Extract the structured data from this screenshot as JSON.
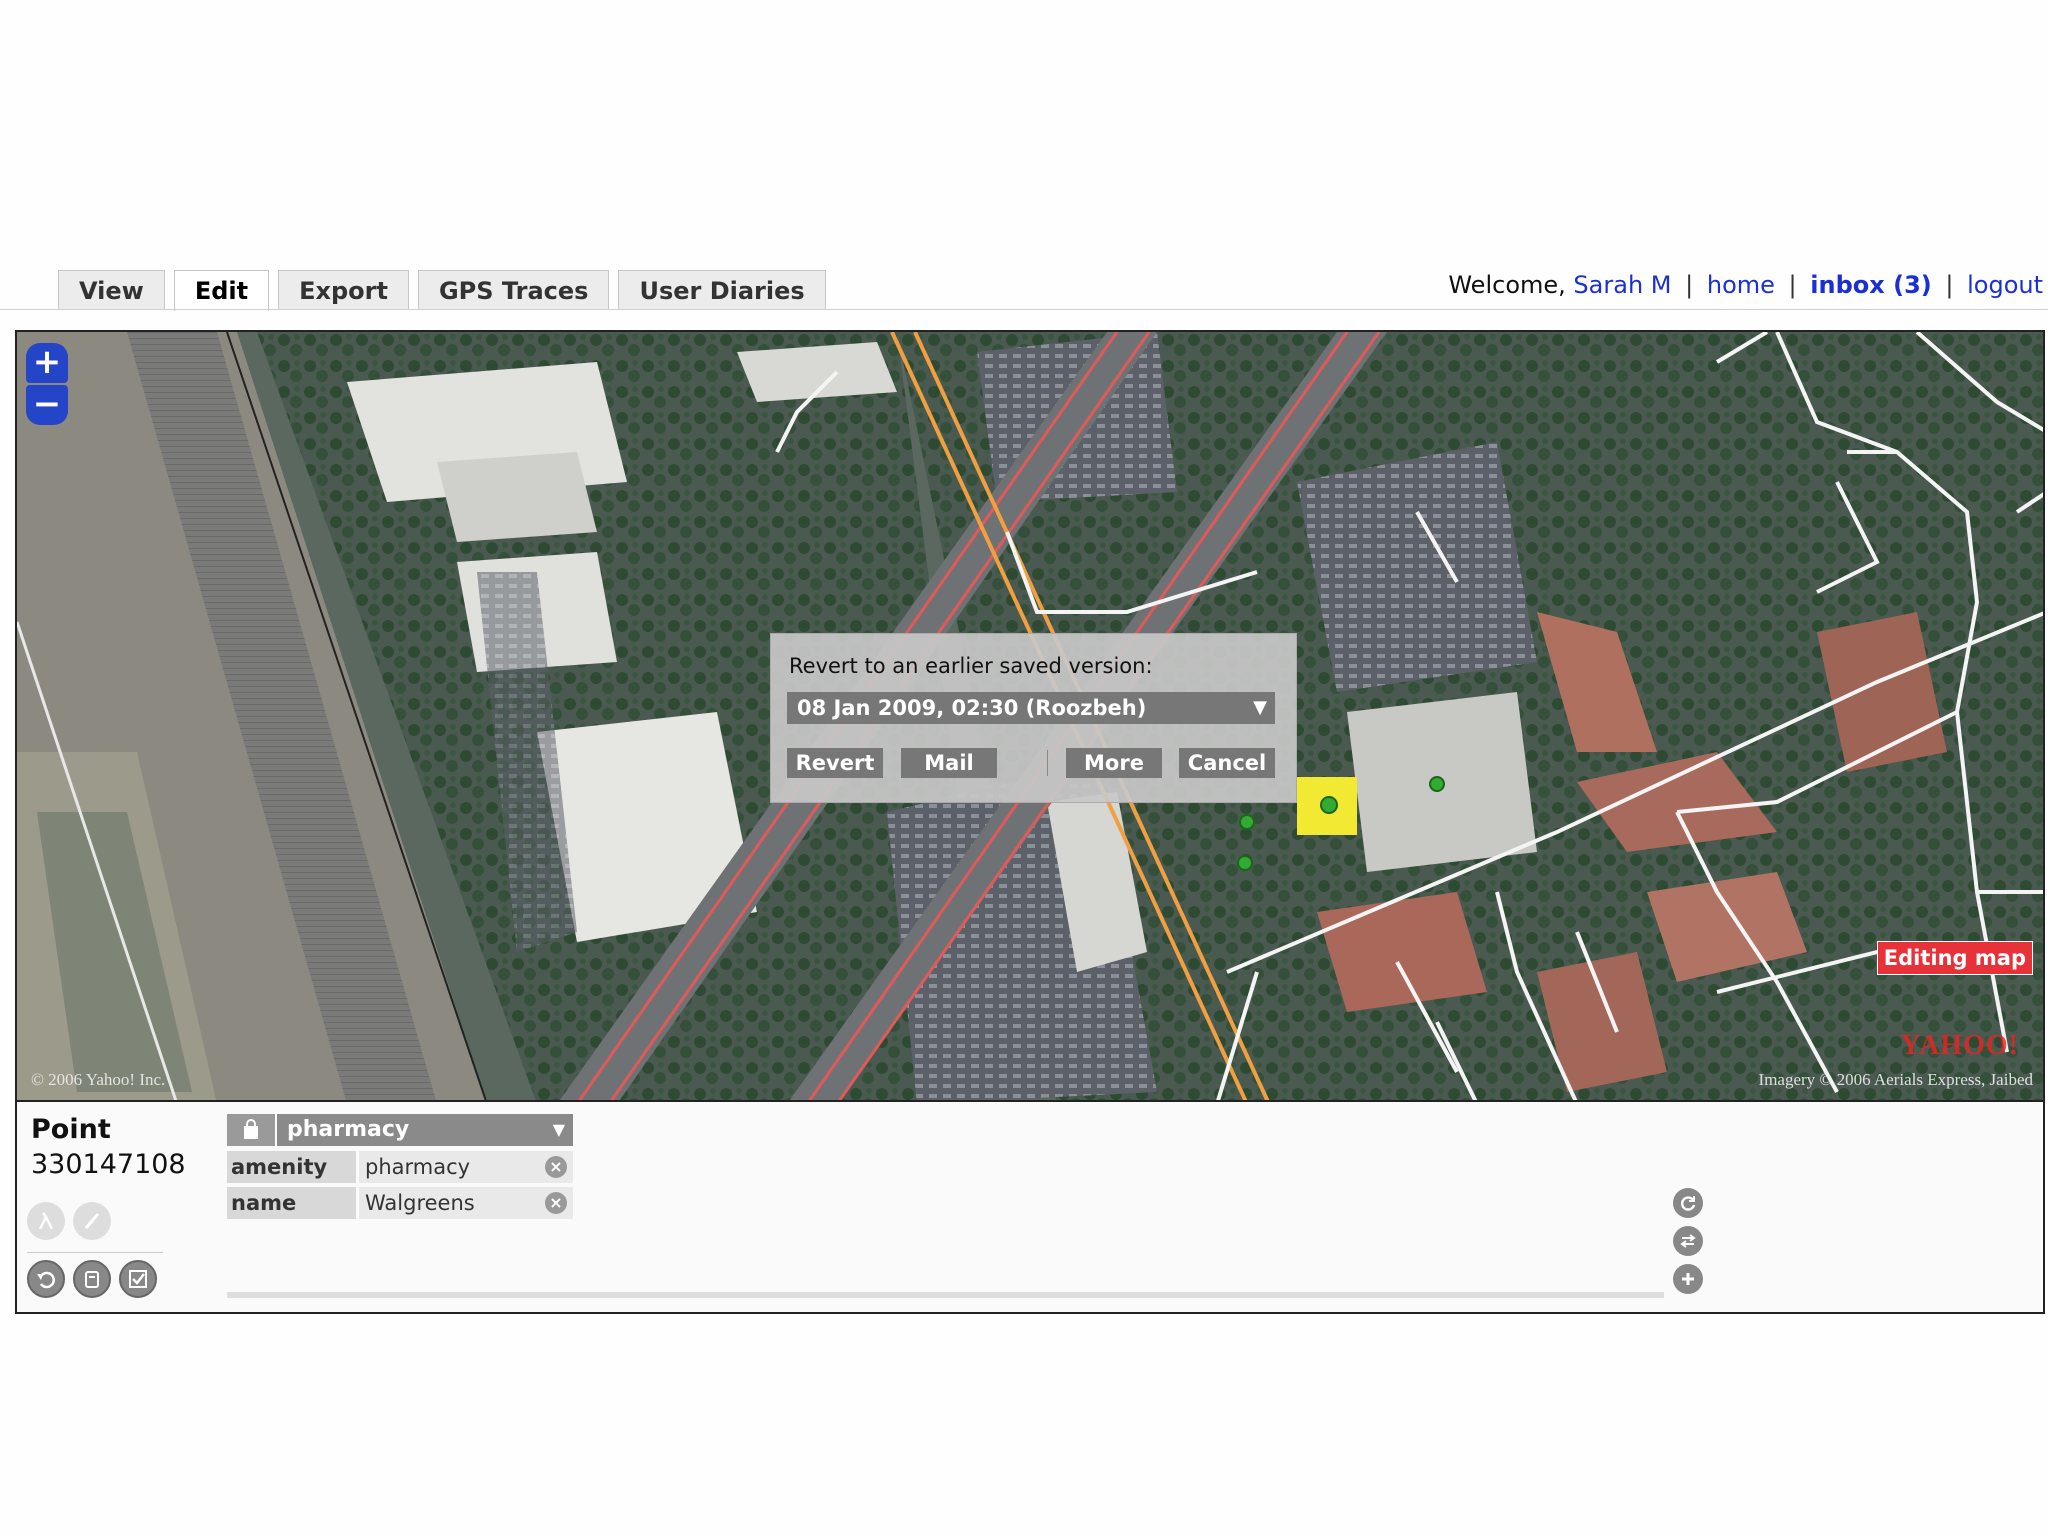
{
  "tabs": [
    "View",
    "Edit",
    "Export",
    "GPS Traces",
    "User Diaries"
  ],
  "active_tab": "Edit",
  "user_bar": {
    "welcome": "Welcome,",
    "username": "Sarah M",
    "home": "home",
    "inbox": "inbox (3)",
    "logout": "logout"
  },
  "map": {
    "zoom_in": "+",
    "zoom_out": "−",
    "copyright": "© 2006 Yahoo! Inc.",
    "imagery_credit": "Imagery © 2006 Aerials Express, Jaibed",
    "yahoo_logo": "YAHOO!",
    "editing_badge": "Editing map"
  },
  "revert_dialog": {
    "title": "Revert to an earlier saved version:",
    "selected_version": "08 Jan 2009, 02:30 (Roozbeh)",
    "buttons": {
      "revert": "Revert",
      "mail": "Mail",
      "more": "More",
      "cancel": "Cancel"
    }
  },
  "properties": {
    "object_type": "Point",
    "object_id": "330147108",
    "preset": "pharmacy",
    "tags": [
      {
        "key": "amenity",
        "value": "pharmacy"
      },
      {
        "key": "name",
        "value": "Walgreens"
      }
    ]
  },
  "colors": {
    "tab_link": "#1a2fd6",
    "zoom_button": "#2445c8",
    "editing_badge": "#e8323a",
    "motorway": "#e05a5a",
    "primary_road": "#f0a040",
    "selected_poi": "#f2e933",
    "poi_dot": "#33aa33"
  },
  "icons": {
    "zoom_in": "plus-icon",
    "zoom_out": "minus-icon",
    "preset": "shopping-bag-icon",
    "remove_tag": "close-circle-icon",
    "undo": "undo-icon",
    "clipboard": "clipboard-icon",
    "check": "check-icon",
    "history": "history-icon",
    "transfer": "swap-icon",
    "add": "add-icon"
  }
}
